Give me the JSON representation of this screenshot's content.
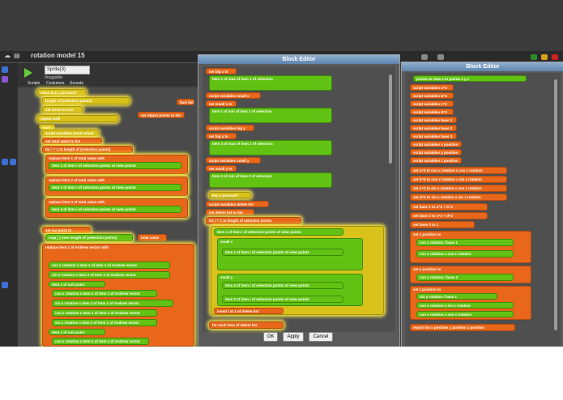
{
  "window": {
    "project_title": "rotation model 15"
  },
  "sprite": {
    "name": "Sprite(3)",
    "draggable_label": "draggable"
  },
  "tabs": [
    {
      "label": "Scripts"
    },
    {
      "label": "Costumes"
    },
    {
      "label": "Sounds"
    }
  ],
  "main_script": {
    "when_key": "when key y pressed?",
    "length_block": "length of (selection points)",
    "set_move": "set move to true",
    "repeat_until": "repeat until",
    "mouse_down": "mouse down?",
    "false_val": "false",
    "warp": "warp",
    "script_variables": "script variables (total value)",
    "set_total_value": "set total value to list",
    "for_loop": "for i = 1 to length of (selection points)",
    "replace_item_1": "replace item 1 of total value with",
    "item_of_item_1": "item 1 of item i of selection points of view points",
    "replace_item_2": "replace item 2 of total value with",
    "item_of_item_2": "item 2 of item i of selection points of view points",
    "replace_item_3": "replace item 3 of total value with",
    "item_of_item_3": "item 3 of item i of selection points of view points",
    "set_var_point": "set var point to",
    "map_block": "map ( ) over length of (selection points)",
    "total_value": "total value",
    "replace_andrew": "replace item 1 of Andrew vector with",
    "cos_rotation": "cos x rotation x item 1 of item 1 of Andrew vector",
    "sin_rotation": "sin x rotation x item 2 of item 1 of Andrew vector",
    "unit_point": "item 1 of unit point",
    "andrew_vector": "Andrew vector",
    "object_points_label": "set object points to list",
    "face_list": "face list"
  },
  "block_editor_center": {
    "title": "Block Editor",
    "rows": [
      "set big x to",
      "item 1 of max of item 1 of selection",
      "script variables small x",
      "set small x to",
      "item 1 of min of item 1 of selection",
      "script variables big y",
      "set big y to",
      "item 2 of max of item 2 of selection",
      "script variables small y",
      "set small y to",
      "item 2 of min of item 2 of selection",
      "key y pressed?",
      "script variables delete list",
      "set delete list to list",
      "for i = 1 to length of selection points",
      "item 1 of item i of selection points of view points",
      "big x",
      "small x",
      "item 2 of item i of selection points of view points",
      "big y",
      "small y",
      "insert i at 1 of delete list",
      "for each item of delete list"
    ],
    "ok": "OK",
    "apply": "Apply",
    "cancel": "Cancel"
  },
  "block_editor_right": {
    "title": "Block Editor",
    "header": "points to view x to points x y z",
    "rows": [
      "script variables a^2",
      "script variables b^2",
      "script variables c^2",
      "script variables d^2",
      "script variables base 1",
      "script variables base 2",
      "script variables base 3",
      "script variables x position",
      "script variables y position",
      "script variables z position",
      "set a^2 to cos x rotation x cos z rotation",
      "set b^2 to cos x rotation x sin z rotation",
      "set c^2 to sin x rotation x cos z rotation",
      "set d^2 to sin x rotation x sin z rotation",
      "set base 1 to a^2 + b^2",
      "set base 2 to c^2 + d^2",
      "set base 3 to z",
      "set x position to",
      "cos z rotation / base 1",
      "cos x rotation x cos z rotation",
      "set y position to",
      "cos x rotation / base 2",
      "sin y rotation x sin x rotation",
      "set z position to",
      "sin y rotation / base 1",
      "cos x rotation x sin x rotation",
      "cos x rotation x cos x rotation",
      "report list x position y position z position"
    ]
  },
  "colors": {
    "control": "#e8671a",
    "operators": "#62c213",
    "variables": "#d9c21a",
    "dialog_title": "#6e93bb"
  }
}
